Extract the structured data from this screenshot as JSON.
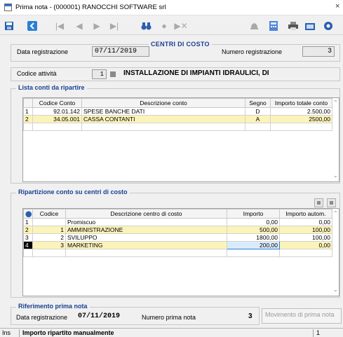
{
  "window": {
    "title": "Prima nota - (000001) RANOCCHI SOFTWARE srl",
    "close_label": "×"
  },
  "toolbar": {
    "icons": [
      "save-icon",
      "back-icon",
      "first-icon",
      "prev-icon",
      "next-icon",
      "last-icon",
      "binoculars-icon",
      "circle-icon",
      "skip-icon",
      "bell-icon",
      "calculator-icon",
      "print-icon",
      "export-icon",
      "extra-icon"
    ]
  },
  "header": {
    "title": "CENTRI DI COSTO",
    "date_label": "Data registrazione",
    "date_value": "07/11/2019",
    "number_label": "Numero registrazione",
    "number_value": "3"
  },
  "activity": {
    "label": "Codice attività",
    "code": "1",
    "description": "INSTALLAZIONE DI IMPIANTI IDRAULICI, DI"
  },
  "accounts": {
    "section_title": "Lista conti da ripartire",
    "columns": [
      "",
      "Codice Conto",
      "Descrizione conto",
      "Segno",
      "Importo totale conto"
    ],
    "rows": [
      {
        "idx": "1",
        "code": "92.01.142",
        "desc": "SPESE BANCHE DATI",
        "sign": "D",
        "amount": "2.500,00"
      },
      {
        "idx": "2",
        "code": "34.05.001",
        "desc": "CASSA CONTANTI",
        "sign": "A",
        "amount": "2500,00"
      }
    ]
  },
  "allocation": {
    "section_title": "Ripartizione conto su centri di costo",
    "columns": [
      "",
      "Codice",
      "Descrizione centro di costo",
      "Importo",
      "Importo autom."
    ],
    "rows": [
      {
        "idx": "1",
        "code": "",
        "desc": "Promiscuo",
        "amount": "0,00",
        "auto": "0,00"
      },
      {
        "idx": "2",
        "code": "1",
        "desc": "AMMINISTRAZIONE",
        "amount": "500,00",
        "auto": "100,00"
      },
      {
        "idx": "3",
        "code": "2",
        "desc": "SVILUPPO",
        "amount": "1800,00",
        "auto": "100,00"
      },
      {
        "idx": "4",
        "code": "3",
        "desc": "MARKETING",
        "amount": "200,00",
        "auto": "0,00"
      }
    ]
  },
  "reference": {
    "section_title": "Riferimento prima nota",
    "date_label": "Data registrazione",
    "date_value": "07/11/2019",
    "number_label": "Numero prima nota",
    "number_value": "3",
    "button_label": "Movimento di prima nota"
  },
  "status": {
    "mode": "Ins",
    "message": "Importo ripartito manualmente",
    "count": "1"
  },
  "colors": {
    "accent": "#1a3f93",
    "highlight_row": "#fcf3b9",
    "toolbar_icon": "#2b5fb0"
  }
}
